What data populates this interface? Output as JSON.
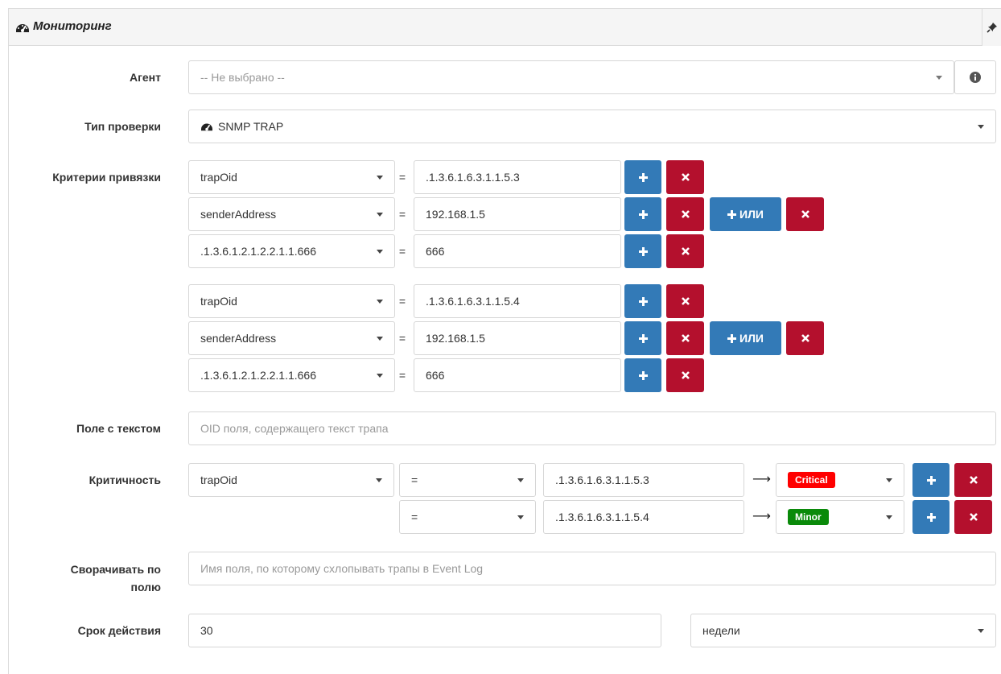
{
  "panel": {
    "title": "Мониторинг"
  },
  "agent": {
    "label": "Агент",
    "placeholder": "-- Не выбрано --"
  },
  "check_type": {
    "label": "Тип проверки",
    "value": "SNMP TRAP"
  },
  "criteria": {
    "label": "Критерии привязки",
    "eq": "=",
    "or_button": "ИЛИ",
    "groups": [
      {
        "rows": [
          {
            "field": "trapOid",
            "value": ".1.3.6.1.6.3.1.1.5.3"
          },
          {
            "field": "senderAddress",
            "value": "192.168.1.5"
          },
          {
            "field": ".1.3.6.1.2.1.2.2.1.1.666",
            "value": "666"
          }
        ]
      },
      {
        "rows": [
          {
            "field": "trapOid",
            "value": ".1.3.6.1.6.3.1.1.5.4"
          },
          {
            "field": "senderAddress",
            "value": "192.168.1.5"
          },
          {
            "field": ".1.3.6.1.2.1.2.2.1.1.666",
            "value": "666"
          }
        ]
      }
    ]
  },
  "text_field": {
    "label": "Поле с текстом",
    "placeholder": "OID поля, содержащего текст трапа"
  },
  "severity": {
    "label": "Критичность",
    "field": "trapOid",
    "rules": [
      {
        "operator": "=",
        "value": ".1.3.6.1.6.3.1.1.5.3",
        "level": "Critical",
        "color": "#ff0000"
      },
      {
        "operator": "=",
        "value": ".1.3.6.1.6.3.1.1.5.4",
        "level": "Minor",
        "color": "#0a8a0a"
      }
    ]
  },
  "collapse": {
    "label_line1": "Сворачивать по",
    "label_line2": "полю",
    "placeholder": "Имя поля, по которому схлопывать трапы в Event Log"
  },
  "validity": {
    "label": "Срок действия",
    "value": "30",
    "unit": "недели"
  }
}
